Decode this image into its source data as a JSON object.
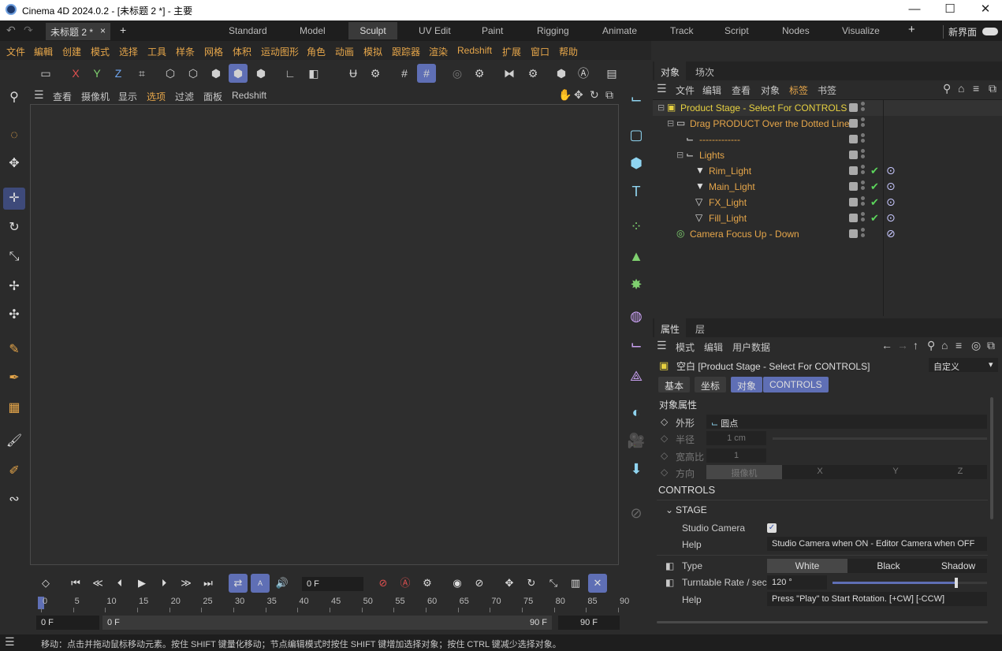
{
  "window": {
    "title": "Cinema 4D 2024.0.2 - [未标题 2 *] - 主要",
    "minimize": "—",
    "maximize": "☐",
    "close": "✕"
  },
  "document_tab": {
    "label": "未标题 2 *",
    "close": "×",
    "add": "+"
  },
  "layouts": [
    "Standard",
    "Model",
    "Sculpt",
    "UV Edit",
    "Paint",
    "Rigging",
    "Animate",
    "Track",
    "Script",
    "Nodes",
    "Visualize"
  ],
  "layout_active": "Sculpt",
  "layout_add": "+",
  "new_ui": "新界面",
  "main_menu": [
    "文件",
    "編輯",
    "创建",
    "模式",
    "选择",
    "工具",
    "样条",
    "网格",
    "体积",
    "运动图形",
    "角色",
    "动画",
    "模拟",
    "跟踪器",
    "渲染",
    "Redshift",
    "扩展",
    "窗口",
    "帮助"
  ],
  "axis": {
    "x": "X",
    "y": "Y",
    "z": "Z"
  },
  "view_menu": [
    "查看",
    "摄像机",
    "显示",
    "选项",
    "过滤",
    "面板",
    "Redshift"
  ],
  "timeline": {
    "current_frame": "0 F",
    "start": "0 F",
    "preview_start": "0 F",
    "preview_end": "90 F",
    "end": "90 F",
    "ticks": [
      "0",
      "5",
      "10",
      "15",
      "20",
      "25",
      "30",
      "35",
      "40",
      "45",
      "50",
      "55",
      "60",
      "65",
      "70",
      "75",
      "80",
      "85",
      "90"
    ]
  },
  "status": "移动：点击并拖动鼠标移动元素。按住 SHIFT 键量化移动；节点编辑模式时按住 SHIFT 键增加选择对象；按住 CTRL 键减少选择对象。",
  "object_panel": {
    "tabs": [
      "对象",
      "场次"
    ],
    "menu": [
      "文件",
      "编辑",
      "查看",
      "对象",
      "标签",
      "书签"
    ],
    "objects": [
      {
        "name": "Product Stage - Select For CONTROLS",
        "indent": 0,
        "icon": "null-clapper-icon",
        "expander": "⊟",
        "highlight": true
      },
      {
        "name": "Drag PRODUCT Over the Dotted Line",
        "indent": 1,
        "icon": "folder-icon",
        "expander": "⊟"
      },
      {
        "name": "-------------",
        "indent": 2,
        "icon": "null-icon",
        "expander": ""
      },
      {
        "name": "Lights",
        "indent": 2,
        "icon": "null-icon",
        "expander": "⊟"
      },
      {
        "name": "Rim_Light",
        "indent": 3,
        "icon": "spot-light-icon",
        "expander": "",
        "tags": true
      },
      {
        "name": "Main_Light",
        "indent": 3,
        "icon": "spot-light-icon",
        "expander": "",
        "tags": true
      },
      {
        "name": "FX_Light",
        "indent": 3,
        "icon": "area-light-icon",
        "expander": "",
        "tags": true
      },
      {
        "name": "Fill_Light",
        "indent": 3,
        "icon": "area-light-icon",
        "expander": "",
        "tags": true
      },
      {
        "name": "Camera Focus Up - Down",
        "indent": 1,
        "icon": "target-icon",
        "expander": "",
        "forbidden": true
      }
    ]
  },
  "attr_panel": {
    "tabs": [
      "属性",
      "层"
    ],
    "menu": [
      "模式",
      "编辑",
      "用户数据"
    ],
    "object_title": "空白 [Product Stage - Select For CONTROLS]",
    "preset": "自定义",
    "pills": [
      "基本",
      "坐标",
      "对象",
      "CONTROLS"
    ],
    "section_object": "对象属性",
    "shape_label": "外形",
    "shape_value": "圆点",
    "radius_label": "半径",
    "radius_value": "1 cm",
    "aspect_label": "宽高比",
    "aspect_value": "1",
    "orient_label": "方向",
    "orient_options": [
      "摄像机",
      "X",
      "Y",
      "Z"
    ],
    "section_controls": "CONTROLS",
    "group_stage": "STAGE",
    "studio_camera_label": "Studio Camera",
    "help1_label": "Help",
    "help1_value": "Studio Camera when ON - Editor Camera when OFF",
    "type_label": "Type",
    "type_options": [
      "White",
      "Black",
      "Shadow"
    ],
    "rate_label": "Turntable Rate / sec",
    "rate_value": "120 °",
    "rate_fraction": 0.8,
    "help2_label": "Help",
    "help2_value": "Press \"Play\" to Start Rotation. [+CW] [-CCW]"
  }
}
